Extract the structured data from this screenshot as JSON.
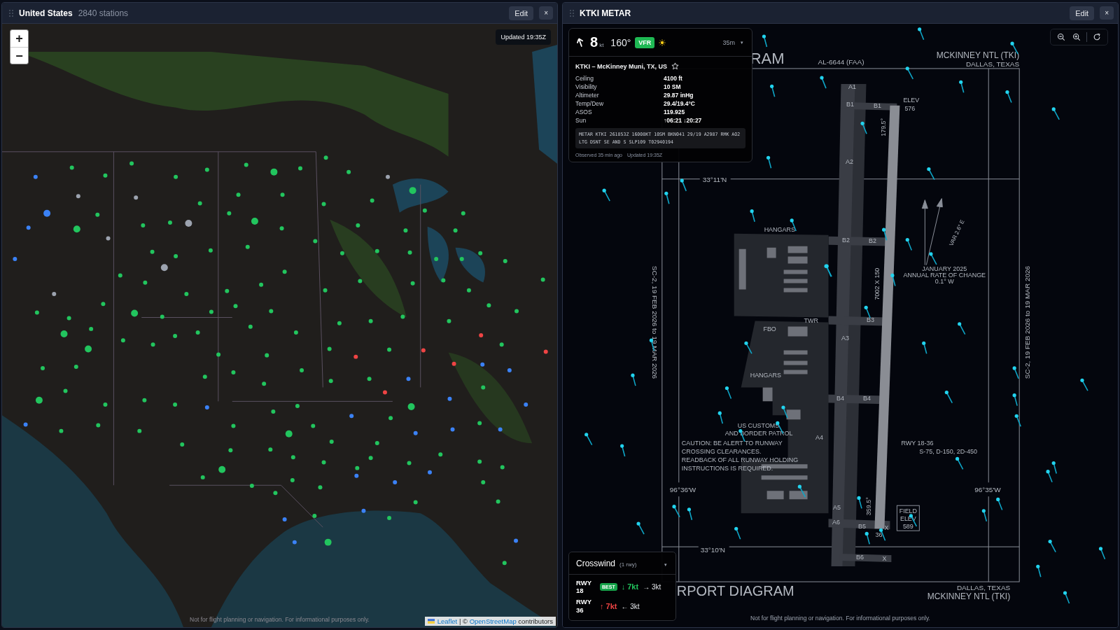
{
  "map_panel": {
    "title": "United States",
    "subtitle": "2840 stations",
    "edit_button": "Edit",
    "close_button": "×",
    "zoom_in": "+",
    "zoom_out": "−",
    "updated": "Updated 19:35Z",
    "disclaimer": "Not for flight planning or navigation. For informational purposes only.",
    "attribution": {
      "links": [
        "Leaflet",
        "OpenStreetMap"
      ],
      "separator": "| ©",
      "suffix": "contributors"
    }
  },
  "metar_panel": {
    "title": "KTKI METAR",
    "edit_button": "Edit",
    "close_button": "×",
    "metar_card": {
      "wind_speed": "8",
      "wind_unit": "kt",
      "wind_direction": "160°",
      "flight_category": {
        "label": "VFR",
        "kind": "vfr"
      },
      "age": "35m",
      "caret": "▾",
      "station": "KTKI – McKinney Muni, TX, US",
      "favorite": false,
      "fields": [
        {
          "label": "Ceiling",
          "value": "4100 ft"
        },
        {
          "label": "Visibility",
          "value": "10 SM"
        },
        {
          "label": "Altimeter",
          "value": "29.87 inHg"
        },
        {
          "label": "Temp/Dew",
          "value": "29.4/19.4°C"
        },
        {
          "label": "ASOS",
          "value": "119.925"
        },
        {
          "label": "Sun",
          "value": "↑06:21 ↓20:27"
        }
      ],
      "raw": "METAR KTKI 261853Z 16008KT 10SM BKN041 29/19 A2987 RMK AO2 LTG DSNT SE AND S SLP109 T02940194",
      "observed": "Observed 35 min ago",
      "updated": "Updated 19:35Z"
    },
    "crosswind": {
      "title": "Crosswind",
      "count": "(1 rwy)",
      "caret": "▾",
      "runways": [
        {
          "label": "RWY 18",
          "best": true,
          "badge": "BEST",
          "color": "#22c55e",
          "headwind": "↓ 7kt",
          "crosswind": "→ 3kt"
        },
        {
          "label": "RWY 36",
          "best": false,
          "color": "#ef4444",
          "headwind": "↑ 7kt",
          "crosswind": "← 3kt"
        }
      ]
    },
    "diagram": {
      "labels": [
        "RAM",
        "AL-6644 (FAA)",
        "MCKINNEY NTL (TKI)",
        "DALLAS, TEXAS",
        "A1",
        "ELEV",
        "B1",
        "B1",
        "576",
        "179.5°",
        "A2",
        "33°11'N",
        "VAR 2.6° E",
        "HANGARS",
        "B2",
        "B2",
        "JANUARY 2025",
        "ANNUAL RATE OF CHANGE",
        "0.1° W",
        "7002 X 150",
        "SC-2, 19 FEB 2026 to 19 MAR 2026",
        "SC-2, 19 FEB 2026 to 19 MAR 2026",
        "TWR",
        "B3",
        "FBO",
        "A3",
        "HANGARS",
        "B4",
        "B4",
        "US CUSTOMS",
        "AND BORDER PATROL",
        "A4",
        "CAUTION:  BE ALERT TO RUNWAY",
        "RWY  18-36",
        "CROSSING CLEARANCES.",
        "S-75, D-150, 2D-450",
        "READBACK OF ALL RUNWAY HOLDING",
        "INSTRUCTIONS IS REQUIRED.",
        "96°36'W",
        "96°35'W",
        "359.5°",
        "A5",
        "FIELD",
        "ELEV",
        "A6",
        "B5",
        "X",
        "589",
        "36",
        "33°10'N",
        "B6",
        "X",
        "DALLAS, TEXAS",
        "RPORT DIAGRAM",
        "MCKINNEY NTL (TKI)"
      ]
    },
    "disclaimer": "Not for flight planning or navigation. For informational purposes only."
  }
}
